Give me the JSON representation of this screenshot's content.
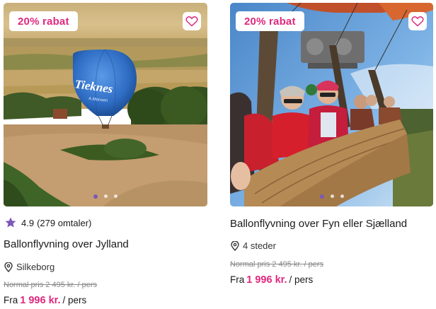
{
  "colors": {
    "accent": "#e0287d",
    "star": "#7c58b8"
  },
  "cards": [
    {
      "badge": "20% rabat",
      "rating": "4.9",
      "reviews": "(279 omtaler)",
      "title": "Ballonflyvning over Jylland",
      "location": "Silkeborg",
      "normal_price": "Normal pris 2 495 kr. / pers",
      "price_prefix": "Fra",
      "price": "1 996 kr.",
      "price_suffix": "/ pers",
      "balloon_text": "Tieknes",
      "balloon_subtext": "A.Monsen"
    },
    {
      "badge": "20% rabat",
      "title": "Ballonflyvning over Fyn eller Sjælland",
      "location": "4 steder",
      "normal_price": "Normal pris 2 495 kr. / pers",
      "price_prefix": "Fra",
      "price": "1 996 kr.",
      "price_suffix": "/ pers"
    }
  ],
  "icons": [
    "heart-icon",
    "star-icon",
    "location-pin-icon"
  ]
}
